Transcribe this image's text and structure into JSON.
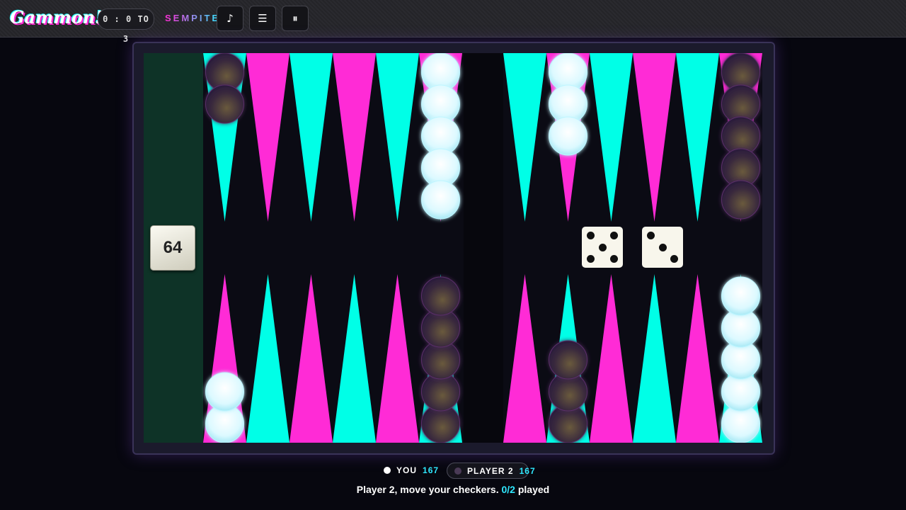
{
  "header": {
    "logo": "Gammon!",
    "score": "0 : 0 TO 3",
    "brand": "SEMPITE",
    "music_icon": "♪",
    "menu_icon": "☰",
    "pause_icon": "⏸"
  },
  "colors": {
    "magenta": "#ff2bd6",
    "cyan": "#00ffe7",
    "white_checker": "#e6fbff",
    "dark_checker": "#3a2a3e",
    "board": "#0b0b14",
    "home_bar": "#0e3327"
  },
  "board": {
    "doubling_cube": "64",
    "dice": [
      5,
      3
    ],
    "points": [
      {
        "owner": "white",
        "count": 5
      },
      {
        "owner": null,
        "count": 0
      },
      {
        "owner": null,
        "count": 0
      },
      {
        "owner": null,
        "count": 0
      },
      {
        "owner": "dark",
        "count": 3
      },
      {
        "owner": null,
        "count": 0
      },
      {
        "owner": "dark",
        "count": 5
      },
      {
        "owner": null,
        "count": 0
      },
      {
        "owner": null,
        "count": 0
      },
      {
        "owner": null,
        "count": 0
      },
      {
        "owner": null,
        "count": 0
      },
      {
        "owner": "white",
        "count": 2
      },
      {
        "owner": "dark",
        "count": 2
      },
      {
        "owner": null,
        "count": 0
      },
      {
        "owner": null,
        "count": 0
      },
      {
        "owner": null,
        "count": 0
      },
      {
        "owner": null,
        "count": 0
      },
      {
        "owner": "white",
        "count": 5
      },
      {
        "owner": null,
        "count": 0
      },
      {
        "owner": "white",
        "count": 3
      },
      {
        "owner": null,
        "count": 0
      },
      {
        "owner": null,
        "count": 0
      },
      {
        "owner": null,
        "count": 0
      },
      {
        "owner": "dark",
        "count": 5
      }
    ]
  },
  "players": {
    "you": {
      "label": "YOU",
      "pips": "167"
    },
    "opponent": {
      "label": "PLAYER 2",
      "pips": "167"
    }
  },
  "status": {
    "message": "Player 2, move your checkers.",
    "progress": "0/2",
    "suffix": "played"
  }
}
